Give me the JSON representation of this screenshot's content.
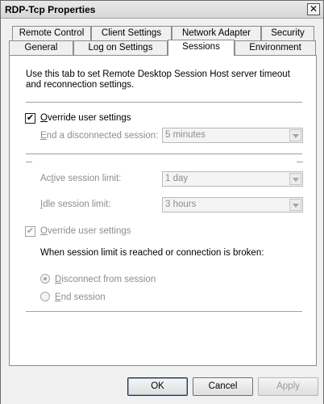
{
  "window": {
    "title": "RDP-Tcp Properties",
    "close_glyph": "✕"
  },
  "tabs_row_back": [
    {
      "label": "Remote Control"
    },
    {
      "label": "Client Settings"
    },
    {
      "label": "Network Adapter"
    },
    {
      "label": "Security"
    }
  ],
  "tabs_row_front": [
    {
      "label": "General"
    },
    {
      "label": "Log on Settings"
    },
    {
      "label": "Sessions",
      "active": true
    },
    {
      "label": "Environment"
    }
  ],
  "sessions": {
    "description": "Use this tab to set Remote Desktop Session Host server timeout and reconnection settings.",
    "override1": {
      "label_first": "O",
      "label_rest": "verride user settings",
      "checked": true
    },
    "end_disconnected": {
      "label_first": "E",
      "label_rest": "nd a disconnected session:",
      "value": "5 minutes"
    },
    "active_limit": {
      "label_pre": "Ac",
      "label_underline": "t",
      "label_rest": "ive session limit:",
      "value": "1 day"
    },
    "idle_limit": {
      "label_first": "I",
      "label_rest": "dle session limit:",
      "value": "3 hours"
    },
    "override2": {
      "label_first": "O",
      "label_rest": "verride user settings",
      "checked": true
    },
    "when_text": "When session limit is reached or connection is broken:",
    "radio_disconnect": {
      "label_first": "D",
      "label_rest": "isconnect from session",
      "checked": true
    },
    "radio_end": {
      "label_first": "E",
      "label_rest": "nd session",
      "checked": false
    }
  },
  "buttons": {
    "ok": "OK",
    "cancel": "Cancel",
    "apply": "Apply"
  }
}
